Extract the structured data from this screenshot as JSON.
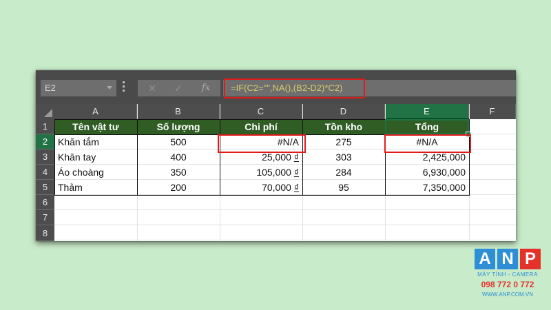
{
  "formula_bar": {
    "name_box": "E2",
    "cancel_symbol": "✕",
    "enter_symbol": "✓",
    "fx_label": "fx",
    "formula": "=IF(C2=\"\",NA(),(B2-D2)*C2)"
  },
  "sheet": {
    "columns": [
      "A",
      "B",
      "C",
      "D",
      "E",
      "F"
    ],
    "rows": [
      "1",
      "2",
      "3",
      "4",
      "5",
      "6",
      "7",
      "8"
    ],
    "selected_cell": "E2",
    "table_header": [
      "Tên vật tư",
      "Số lượng",
      "Chi phí",
      "Tồn kho",
      "Tổng"
    ],
    "data_rows": [
      {
        "name": "Khăn tắm",
        "qty": "500",
        "cost": "#N/A",
        "cost_currency": "",
        "stock": "275",
        "total": "#N/A"
      },
      {
        "name": "Khăn tay",
        "qty": "400",
        "cost": "25,000",
        "cost_currency": "₫",
        "stock": "303",
        "total": "2,425,000"
      },
      {
        "name": "Áo choàng",
        "qty": "350",
        "cost": "105,000",
        "cost_currency": "₫",
        "stock": "284",
        "total": "6,930,000"
      },
      {
        "name": "Thảm",
        "qty": "200",
        "cost": "70,000",
        "cost_currency": "₫",
        "stock": "95",
        "total": "7,350,000"
      }
    ]
  },
  "watermark": {
    "letters": [
      "A",
      "N",
      "P"
    ],
    "tagline": "MÁY TÍNH - CAMERA",
    "phone": "098 772 0 772",
    "website": "WWW.ANP.COM.VN"
  },
  "colors": {
    "background": "#c8ebc9",
    "header_fill": "#2f5d23",
    "selection_green": "#217346",
    "highlight_red": "#e21a1a",
    "formula_text": "#d7cc6c",
    "logo_blue": "#2f8fd6",
    "logo_red": "#e4322b"
  }
}
